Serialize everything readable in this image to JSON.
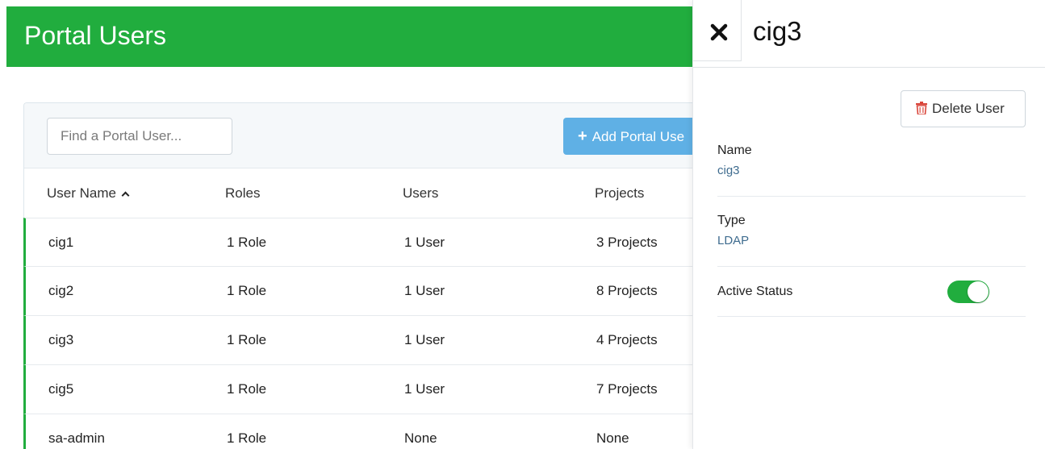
{
  "header": {
    "title": "Portal Users"
  },
  "search": {
    "placeholder": "Find a Portal User..."
  },
  "toolbar": {
    "add_label": "Add Portal Use"
  },
  "table": {
    "columns": [
      "User Name",
      "Roles",
      "Users",
      "Projects"
    ],
    "sort_column": "User Name",
    "rows": [
      {
        "name": "cig1",
        "roles": "1 Role",
        "users": "1 User",
        "projects": "3 Projects"
      },
      {
        "name": "cig2",
        "roles": "1 Role",
        "users": "1 User",
        "projects": "8 Projects"
      },
      {
        "name": "cig3",
        "roles": "1 Role",
        "users": "1 User",
        "projects": "4 Projects"
      },
      {
        "name": "cig5",
        "roles": "1 Role",
        "users": "1 User",
        "projects": "7 Projects"
      },
      {
        "name": "sa-admin",
        "roles": "1 Role",
        "users": "None",
        "projects": "None"
      }
    ]
  },
  "drawer": {
    "title": "cig3",
    "delete_label": "Delete User",
    "name_label": "Name",
    "name_value": "cig3",
    "type_label": "Type",
    "type_value": "LDAP",
    "status_label": "Active Status",
    "active": true
  },
  "colors": {
    "brand_green": "#21ad3e",
    "add_button_blue": "#5fb0e5",
    "delete_red": "#d9453a",
    "value_blue": "#3f6c8f"
  },
  "icons": [
    "plus-icon",
    "caret-up-icon",
    "close-icon",
    "trash-icon"
  ]
}
